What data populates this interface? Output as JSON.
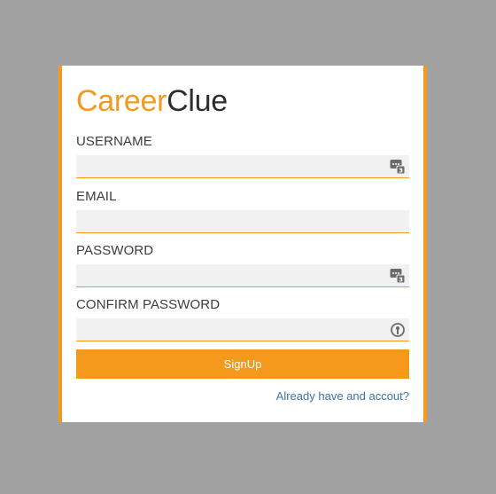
{
  "brand": {
    "part1": "Career",
    "part2": "Clue",
    "accent_color": "#f5991c"
  },
  "form": {
    "fields": [
      {
        "label": "USERNAME",
        "value": "",
        "icon": "password-manager-icon"
      },
      {
        "label": "EMAIL",
        "value": "",
        "icon": ""
      },
      {
        "label": "PASSWORD",
        "value": "",
        "icon": "password-manager-icon"
      },
      {
        "label": "CONFIRM PASSWORD",
        "value": "",
        "icon": "key-lock-icon"
      }
    ],
    "submit_label": "SignUp",
    "login_link": "Already have and accout?"
  }
}
